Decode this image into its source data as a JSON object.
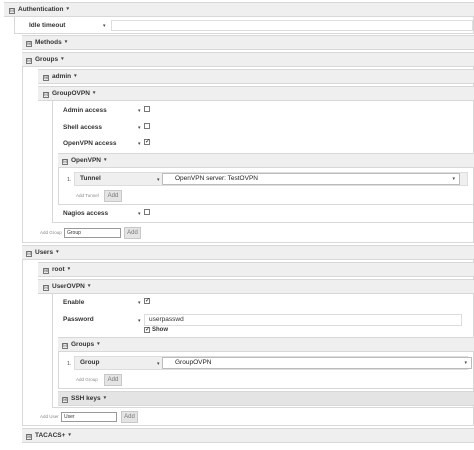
{
  "authentication": {
    "title": "Authentication",
    "idle_timeout": {
      "label": "Idle timeout",
      "value": ""
    },
    "methods": {
      "title": "Methods"
    },
    "groups": {
      "title": "Groups",
      "admin": {
        "title": "admin"
      },
      "groupovpn": {
        "title": "GroupOVPN",
        "admin_access": {
          "label": "Admin access",
          "checked": false
        },
        "shell_access": {
          "label": "Shell access",
          "checked": false
        },
        "openvpn_access": {
          "label": "OpenVPN access",
          "checked": true
        },
        "openvpn": {
          "title": "OpenVPN",
          "row_index": "1.",
          "tunnel": {
            "label": "Tunnel",
            "selected": "OpenVPN server: TestOVPN"
          },
          "add_tunnel_placeholder": "Add Tunnel",
          "add_label": "Add"
        },
        "nagios_access": {
          "label": "Nagios access",
          "checked": false
        }
      },
      "add_group_label": "Add Group",
      "add_group_value": "Group",
      "add_label": "Add"
    },
    "users": {
      "title": "Users",
      "root": {
        "title": "root"
      },
      "userovpn": {
        "title": "UserOVPN",
        "enable": {
          "label": "Enable",
          "checked": true
        },
        "password": {
          "label": "Password",
          "value": "userpasswd",
          "show_label": "Show",
          "show_checked": true
        },
        "groups": {
          "title": "Groups",
          "row_index": "1.",
          "group": {
            "label": "Group",
            "selected": "GroupOVPN"
          },
          "add_group_placeholder": "Add Group",
          "add_label": "Add"
        },
        "ssh_keys": {
          "title": "SSH keys"
        }
      },
      "add_user_label": "Add User",
      "add_user_value": "User",
      "add_label": "Add"
    },
    "tacacs": {
      "title": "TACACS+"
    }
  },
  "icons": {
    "collapse": "⊟",
    "expand": "⊞",
    "caret": "▾",
    "check": "✓"
  }
}
